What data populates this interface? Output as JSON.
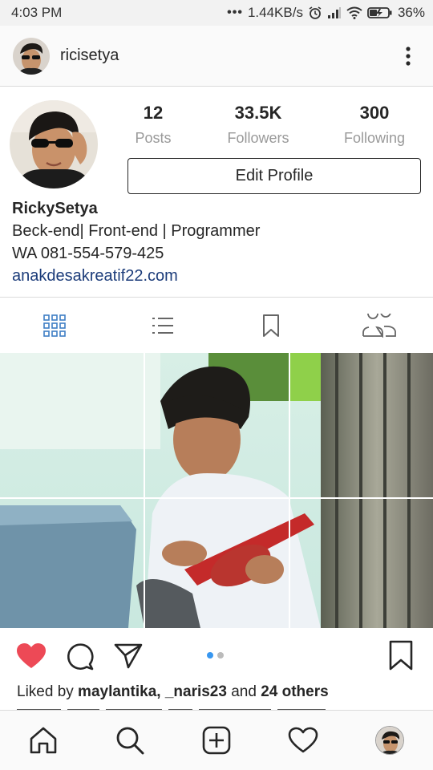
{
  "status_bar": {
    "time": "4:03 PM",
    "net_speed": "1.44KB/s",
    "battery": "36%",
    "icons": [
      "more-dots-icon",
      "alarm-icon",
      "signal-icon",
      "wifi-icon",
      "battery-icon"
    ]
  },
  "header": {
    "username": "ricisetya",
    "more_icon": "vertical-dots-icon"
  },
  "profile": {
    "stats": [
      {
        "value": "12",
        "label": "Posts"
      },
      {
        "value": "33.5K",
        "label": "Followers"
      },
      {
        "value": "300",
        "label": "Following"
      }
    ],
    "edit_label": "Edit Profile",
    "full_name": "RickySetya",
    "bio_line1": "Beck-end| Front-end | Programmer",
    "bio_line2": "WA 081-554-579-425",
    "website": "anakdesakreatif22.com"
  },
  "tabs": [
    "grid-icon",
    "list-icon",
    "bookmark-icon",
    "tagged-people-icon"
  ],
  "post": {
    "liked": true,
    "carousel_pages": 2,
    "carousel_active": 1,
    "likes_prefix": "Liked by ",
    "likes_users": "maylantika, _naris23",
    "likes_mid": " and ",
    "likes_others": "24 others"
  },
  "bottom_nav": [
    "home-icon",
    "search-icon",
    "add-post-icon",
    "activity-heart-icon",
    "profile-avatar"
  ],
  "colors": {
    "accent": "#ed4956",
    "link": "#1c3c7a",
    "carousel_active": "#3897f0",
    "tab_active": "#3f7ec5"
  }
}
